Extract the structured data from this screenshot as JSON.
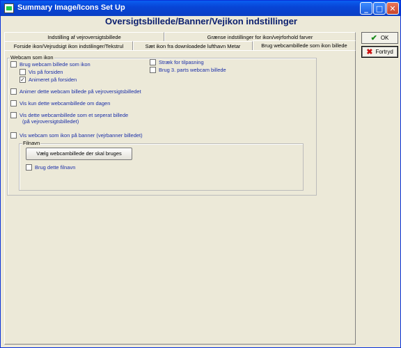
{
  "window": {
    "title": "Summary Image/Icons Set Up",
    "minimize_label": "_",
    "maximize_label": "□",
    "close_label": "✕"
  },
  "heading": "Oversigtsbillede/Banner/Vejikon indstillinger",
  "tabs_row1": [
    {
      "label": "Indstilling af vejroversigtsbillede"
    },
    {
      "label": "Grænse indstillinger for ikon/vejrforhold farver"
    }
  ],
  "tabs_row2": [
    {
      "label": "Forside ikon/Vejrudsigt ikon indstilinger/Tekstrul"
    },
    {
      "label": "Sæt ikon fra downloadede lufthavn Metar"
    },
    {
      "label": "Brug webcambillede som ikon billede"
    }
  ],
  "buttons": {
    "ok_label": "OK",
    "ok_icon": "check-icon",
    "fortryd_label": "Fortryd",
    "fortryd_icon": "x-icon"
  },
  "webcam_group": {
    "legend": "Webcam som ikon",
    "use_as_icon": {
      "label": "Brug webcam billede som ikon",
      "checked": false
    },
    "show_on_front": {
      "label": "Vis på forsiden",
      "checked": false
    },
    "animated_on_front": {
      "label": "Animeret på forsiden",
      "checked": true
    },
    "stretch": {
      "label": "Stræk for tilpasning",
      "checked": false
    },
    "third_party": {
      "label": "Brug 3. parts webcam billede",
      "checked": false
    },
    "animate_on_overview": {
      "label": "Animer dette webcam billede på vejroversigtsbilledet",
      "checked": false
    },
    "show_daytime_only": {
      "label": "Vis kun dette webcambillede om dagen",
      "checked": false
    },
    "separate_image_line1": "Vis dette webcambillede som et seperat billede",
    "separate_image_line2": "(på vejroversigtsbilledet)",
    "separate_image_checked": false,
    "show_on_banner": {
      "label": "Vis webcam som ikon på banner (vejrbanner billedet)",
      "checked": false
    }
  },
  "filename_group": {
    "legend": "Filnavn",
    "choose_button": "Vælg webcambillede der skal bruges",
    "use_filename": {
      "label": "Brug dette filnavn",
      "checked": false
    }
  }
}
